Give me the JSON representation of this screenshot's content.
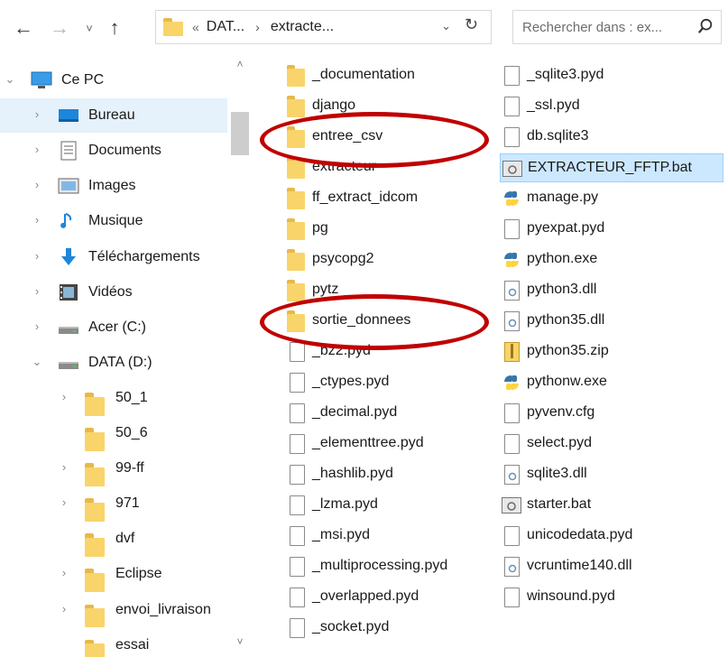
{
  "toolbar": {
    "back": "←",
    "forward": "→",
    "recent": "˅",
    "up": "↑",
    "address_prefix": "«",
    "address_segments": [
      "DAT...",
      "extracte..."
    ],
    "address_separator": "›",
    "address_dropdown": "⌄",
    "refresh": "↻",
    "search_placeholder": "Rechercher dans : ex..."
  },
  "sidebar": {
    "items": [
      {
        "label": "Ce PC",
        "icon": "computer-icon",
        "chevron": "⌄"
      },
      {
        "label": "Bureau",
        "icon": "desktop-icon",
        "chevron": "›",
        "selected": true
      },
      {
        "label": "Documents",
        "icon": "documents-icon",
        "chevron": "›"
      },
      {
        "label": "Images",
        "icon": "images-icon",
        "chevron": "›"
      },
      {
        "label": "Musique",
        "icon": "music-icon",
        "chevron": "›"
      },
      {
        "label": "Téléchargements",
        "icon": "downloads-icon",
        "chevron": "›"
      },
      {
        "label": "Vidéos",
        "icon": "videos-icon",
        "chevron": "›"
      },
      {
        "label": "Acer (C:)",
        "icon": "drive-icon",
        "chevron": "›"
      },
      {
        "label": "DATA (D:)",
        "icon": "drive-icon",
        "chevron": "⌄"
      },
      {
        "label": "50_1",
        "icon": "folder-icon",
        "chevron": "›"
      },
      {
        "label": "50_6",
        "icon": "folder-icon",
        "chevron": ""
      },
      {
        "label": "99-ff",
        "icon": "folder-icon",
        "chevron": "›"
      },
      {
        "label": "971",
        "icon": "folder-icon",
        "chevron": "›"
      },
      {
        "label": "dvf",
        "icon": "folder-icon",
        "chevron": ""
      },
      {
        "label": "Eclipse",
        "icon": "folder-icon",
        "chevron": "›"
      },
      {
        "label": "envoi_livraison",
        "icon": "folder-icon",
        "chevron": "›"
      },
      {
        "label": "essai",
        "icon": "folder-icon",
        "chevron": ""
      }
    ]
  },
  "scrollbar": {
    "up": "˄",
    "down": "˅"
  },
  "files": {
    "column1": [
      {
        "name": "_documentation",
        "type": "folder"
      },
      {
        "name": "django",
        "type": "folder"
      },
      {
        "name": "entree_csv",
        "type": "folder"
      },
      {
        "name": "extracteur",
        "type": "folder"
      },
      {
        "name": "ff_extract_idcom",
        "type": "folder"
      },
      {
        "name": "pg",
        "type": "folder"
      },
      {
        "name": "psycopg2",
        "type": "folder"
      },
      {
        "name": "pytz",
        "type": "folder"
      },
      {
        "name": "sortie_donnees",
        "type": "folder"
      },
      {
        "name": "_bz2.pyd",
        "type": "file"
      },
      {
        "name": "_ctypes.pyd",
        "type": "file"
      },
      {
        "name": "_decimal.pyd",
        "type": "file"
      },
      {
        "name": "_elementtree.pyd",
        "type": "file"
      },
      {
        "name": "_hashlib.pyd",
        "type": "file"
      },
      {
        "name": "_lzma.pyd",
        "type": "file"
      },
      {
        "name": "_msi.pyd",
        "type": "file"
      },
      {
        "name": "_multiprocessing.pyd",
        "type": "file"
      },
      {
        "name": "_overlapped.pyd",
        "type": "file"
      },
      {
        "name": "_socket.pyd",
        "type": "file"
      }
    ],
    "column2": [
      {
        "name": "_sqlite3.pyd",
        "type": "file"
      },
      {
        "name": "_ssl.pyd",
        "type": "file"
      },
      {
        "name": "db.sqlite3",
        "type": "file"
      },
      {
        "name": "EXTRACTEUR_FFTP.bat",
        "type": "bat",
        "selected": true
      },
      {
        "name": "manage.py",
        "type": "python"
      },
      {
        "name": "pyexpat.pyd",
        "type": "file"
      },
      {
        "name": "python.exe",
        "type": "python"
      },
      {
        "name": "python3.dll",
        "type": "dll"
      },
      {
        "name": "python35.dll",
        "type": "dll"
      },
      {
        "name": "python35.zip",
        "type": "zip"
      },
      {
        "name": "pythonw.exe",
        "type": "python"
      },
      {
        "name": "pyvenv.cfg",
        "type": "file"
      },
      {
        "name": "select.pyd",
        "type": "file"
      },
      {
        "name": "sqlite3.dll",
        "type": "dll"
      },
      {
        "name": "starter.bat",
        "type": "bat"
      },
      {
        "name": "unicodedata.pyd",
        "type": "file"
      },
      {
        "name": "vcruntime140.dll",
        "type": "dll"
      },
      {
        "name": "winsound.pyd",
        "type": "file"
      }
    ]
  },
  "colors": {
    "selection": "#cce8ff",
    "annotation": "#c00000",
    "folder": "#f9d46a"
  }
}
